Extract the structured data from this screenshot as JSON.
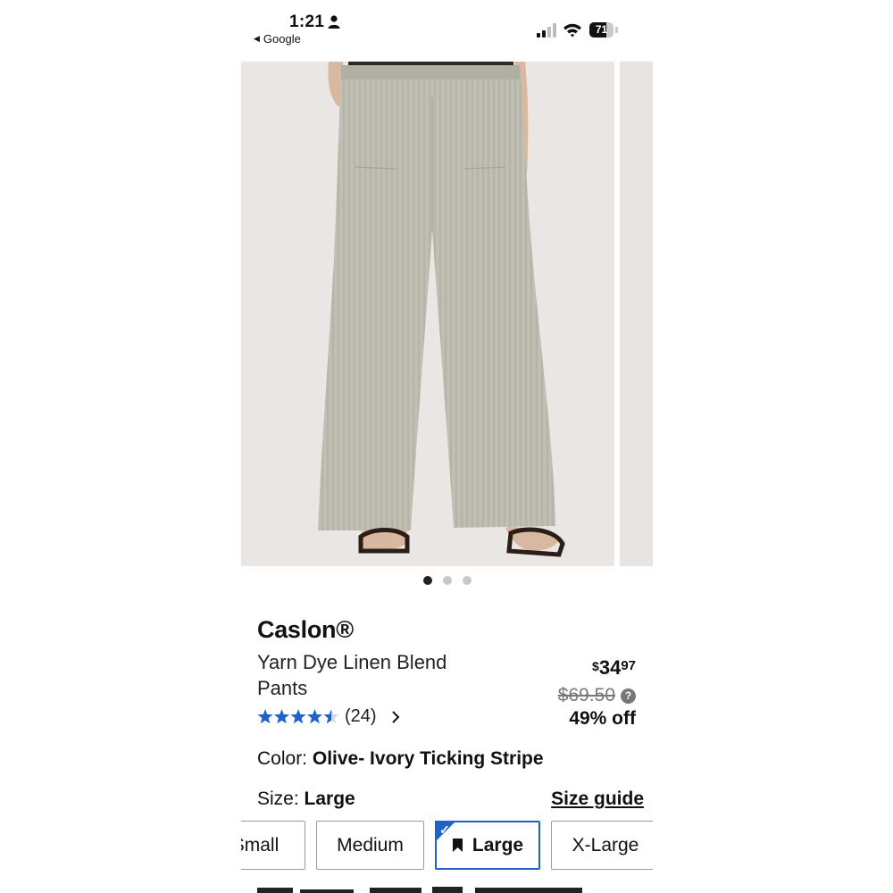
{
  "status_bar": {
    "time": "1:21",
    "back_label": "Google",
    "battery_level": "71",
    "battery_fraction": 0.71
  },
  "carousel": {
    "image_count": 3,
    "active_index": 0
  },
  "product": {
    "brand": "Caslon®",
    "name": "Yarn Dye Linen Blend Pants",
    "rating": 4.5,
    "review_count": "(24)",
    "price_symbol": "$",
    "price_dollars": "34",
    "price_cents": "97",
    "original_price": "$69.50",
    "discount": "49% off"
  },
  "color": {
    "label": "Color: ",
    "value": "Olive- Ivory Ticking Stripe"
  },
  "size": {
    "label": "Size: ",
    "value": "Large",
    "guide_label": "Size guide",
    "options": [
      "Small",
      "Medium",
      "Large",
      "X-Large"
    ],
    "selected": "Large"
  },
  "colors": {
    "accent": "#1f62c9",
    "star": "#1f62c9",
    "text": "#111111",
    "muted": "#777777"
  },
  "icons": {
    "person": "person-icon",
    "signal": "cellular-signal-icon",
    "wifi": "wifi-icon",
    "battery": "battery-icon",
    "help": "help-circle-icon",
    "chevron": "chevron-right-icon",
    "bookmark": "bookmark-icon",
    "check": "checkmark-icon"
  }
}
